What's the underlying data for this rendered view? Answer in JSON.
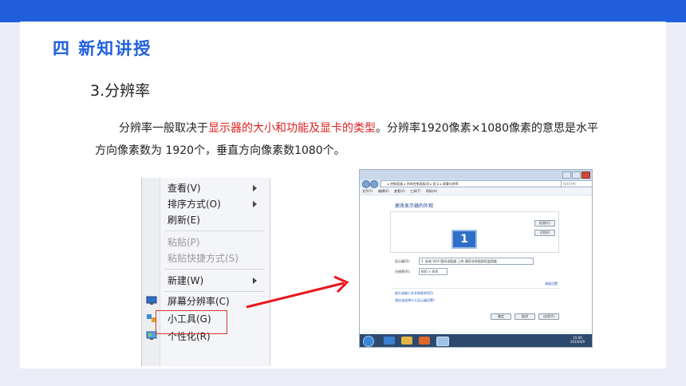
{
  "slide": {
    "heading": "四 新知讲授",
    "subheading": "3.分辨率",
    "paragraph": {
      "part1": "分辨率一般取决于",
      "highlight": "显示器的大小和功能及显卡的类型",
      "part2": "。分辨率1920像素×1080像素的意思是水平方向像素数为 1920个，垂直方向像素数1080个。"
    },
    "colors": {
      "accent": "#1f5fdc",
      "highlight": "#e02020",
      "callout_border": "#d23b2b",
      "arrow": "#e8161b"
    }
  },
  "context_menu": {
    "items": [
      {
        "label": "查看(V)",
        "submenu": true,
        "disabled": false
      },
      {
        "label": "排序方式(O)",
        "submenu": true,
        "disabled": false
      },
      {
        "label": "刷新(E)",
        "submenu": false,
        "disabled": false
      },
      {
        "label": "粘贴(P)",
        "submenu": false,
        "disabled": true
      },
      {
        "label": "粘贴快捷方式(S)",
        "submenu": false,
        "disabled": true
      },
      {
        "label": "新建(W)",
        "submenu": true,
        "disabled": false
      },
      {
        "label": "屏幕分辨率(C)",
        "submenu": false,
        "disabled": false,
        "icon": "display-icon"
      },
      {
        "label": "小工具(G)",
        "submenu": false,
        "disabled": false,
        "icon": "gadgets-icon"
      },
      {
        "label": "个性化(R)",
        "submenu": false,
        "disabled": false,
        "icon": "personalize-icon"
      }
    ]
  },
  "screenshot": {
    "address": "▸ 控制面板 ▸ 所有控制面板项 ▸ 显示 ▸ 屏幕分辨率",
    "search_placeholder": "搜索控制",
    "menu": [
      "文件(F)",
      "编辑(E)",
      "查看(V)",
      "工具(T)",
      "帮助(H)"
    ],
    "title": "更改显示器的外观",
    "monitor_number": "1",
    "detect_button": "检测(C)",
    "identify_button": "识别(I)",
    "display_label": "显示器(S):",
    "display_value": "1. 标准 VGA 图形适配器 上的 通用非即插即用监视器",
    "resolution_label": "分辨率(R):",
    "resolution_value": "800 × 600",
    "advanced_link": "高级设置",
    "link1": "放大或缩小文本和其他项目",
    "link2": "我应该选择什么显示器设置?",
    "ok_button": "确定",
    "cancel_button": "取消",
    "apply_button": "应用(A)",
    "clock_time": "15:00",
    "clock_date": "2014/4/9"
  }
}
